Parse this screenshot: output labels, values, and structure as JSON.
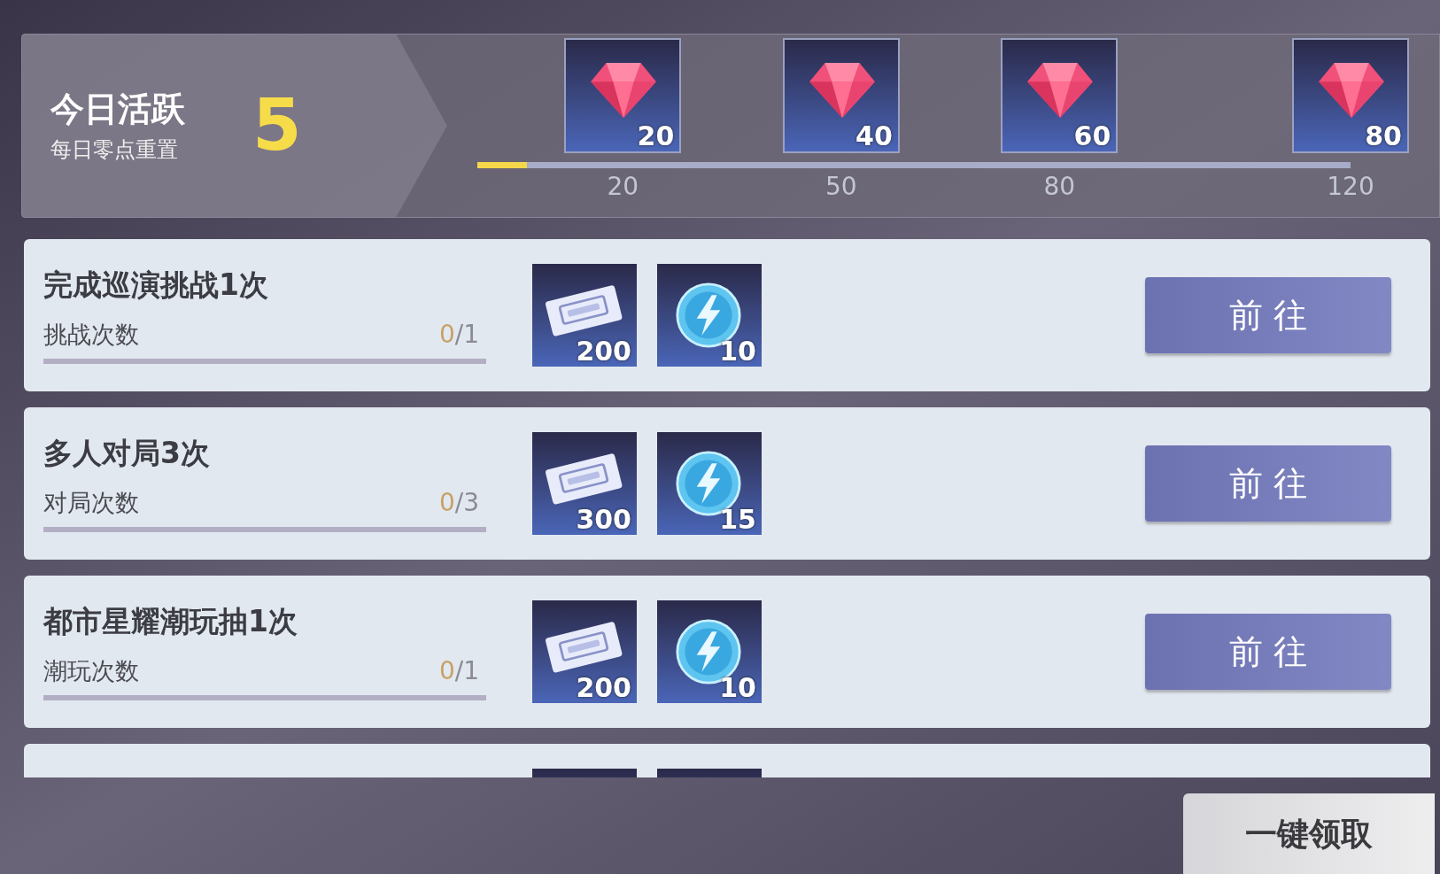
{
  "activity": {
    "title": "今日活跃",
    "subtitle": "每日零点重置",
    "points": "5",
    "level": 0.057,
    "milestones": [
      {
        "kind": "gem",
        "amount": "20",
        "threshold": "20"
      },
      {
        "kind": "gem",
        "amount": "40",
        "threshold": "50"
      },
      {
        "kind": "gem",
        "amount": "60",
        "threshold": "80"
      },
      {
        "kind": "gem",
        "amount": "80",
        "threshold": "120"
      }
    ]
  },
  "tasks": [
    {
      "title": "完成巡演挑战1次",
      "counter": "挑战次数",
      "done": "0",
      "total": "/1",
      "level": 0,
      "rewards": [
        {
          "kind": "ticket",
          "amount": "200"
        },
        {
          "kind": "energy",
          "amount": "10"
        }
      ],
      "button": "前 往"
    },
    {
      "title": "多人对局3次",
      "counter": "对局次数",
      "done": "0",
      "total": "/3",
      "level": 0,
      "rewards": [
        {
          "kind": "ticket",
          "amount": "300"
        },
        {
          "kind": "energy",
          "amount": "15"
        }
      ],
      "button": "前 往"
    },
    {
      "title": "都市星耀潮玩抽1次",
      "counter": "潮玩次数",
      "done": "0",
      "total": "/1",
      "level": 0,
      "rewards": [
        {
          "kind": "ticket",
          "amount": "200"
        },
        {
          "kind": "energy",
          "amount": "10"
        }
      ],
      "button": "前 往"
    },
    {
      "kind": "partial"
    }
  ],
  "claim_all_button": "一键领取"
}
